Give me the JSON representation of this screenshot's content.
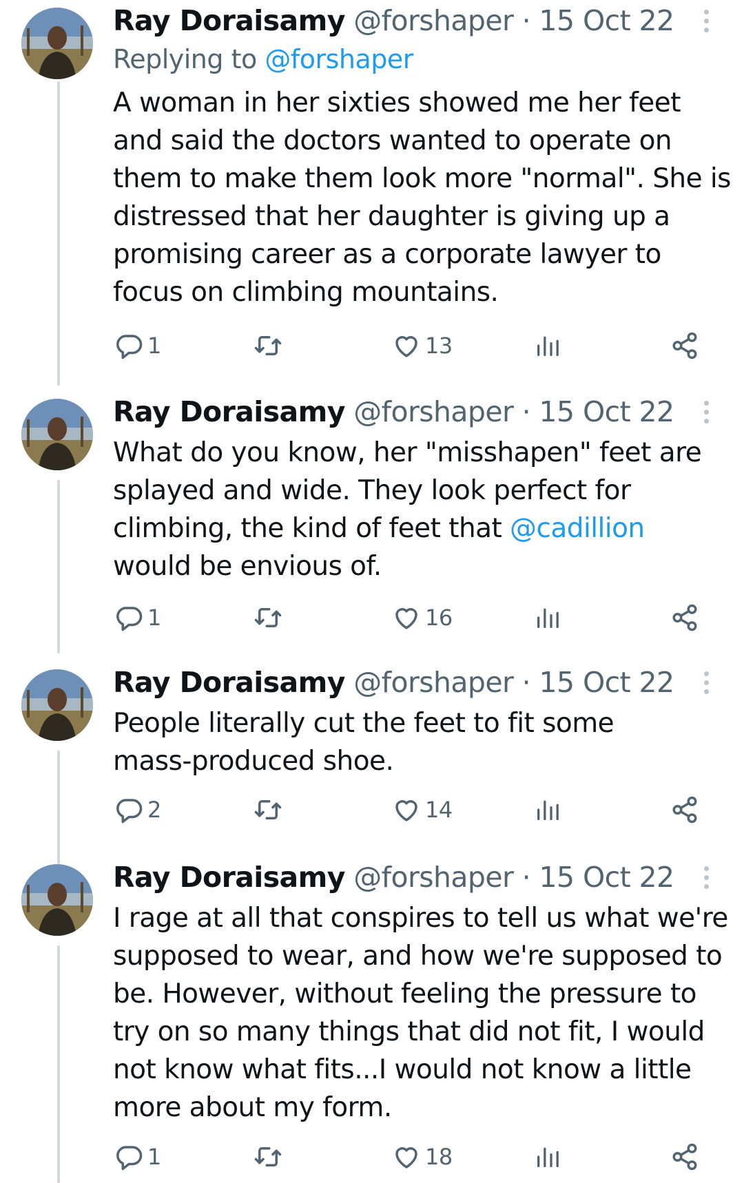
{
  "tweets": [
    {
      "name": "Ray Doraisamy",
      "handle": "@forshaper",
      "sep": "·",
      "date": "15 Oct 22",
      "replying_prefix": "Replying to",
      "replying_handle": "@forshaper",
      "lines": [
        "A woman in her sixties showed me her feet",
        "and said the doctors wanted to operate on",
        "them to make them look more \"normal\". She is",
        "distressed that her daughter is giving up a",
        "promising career as a corporate lawyer to",
        "focus on climbing mountains."
      ],
      "replies": "1",
      "likes": "13"
    },
    {
      "name": "Ray Doraisamy",
      "handle": "@forshaper",
      "sep": "·",
      "date": "15 Oct 22",
      "lines": [
        "What do you know, her \"misshapen\" feet are",
        "splayed and wide. They look perfect for",
        "climbing, the kind of feet that ",
        "would be envious of."
      ],
      "mention": "@cadillion",
      "replies": "1",
      "likes": "16"
    },
    {
      "name": "Ray Doraisamy",
      "handle": "@forshaper",
      "sep": "·",
      "date": "15 Oct 22",
      "lines": [
        "People literally cut the feet to fit some",
        "mass-produced shoe."
      ],
      "replies": "2",
      "likes": "14"
    },
    {
      "name": "Ray Doraisamy",
      "handle": "@forshaper",
      "sep": "·",
      "date": "15 Oct 22",
      "lines": [
        "I rage at all that conspires to tell us what we're",
        "supposed to wear, and how we're supposed to",
        "be. However, without feeling the pressure to",
        "try on so many things that did not fit, I would",
        "not know what fits...I would not know a little",
        "more about my form."
      ],
      "replies": "1",
      "likes": "18"
    }
  ],
  "icons": {
    "reply": "reply-icon",
    "retweet": "retweet-icon",
    "like": "like-icon",
    "views": "views-icon",
    "share": "share-icon",
    "more": "more-icon"
  },
  "colors": {
    "text": "#0f1419",
    "secondary": "#536471",
    "link": "#1d9bf0",
    "thread_line": "#cfd9de"
  }
}
